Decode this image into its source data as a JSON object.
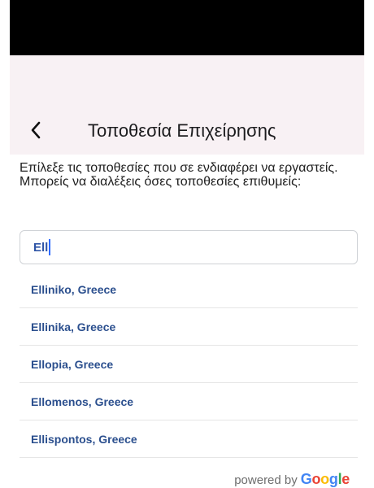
{
  "header": {
    "title": "Τοποθεσία Επιχείρησης"
  },
  "description": "Επίλεξε τις τοποθεσίες που σε ενδιαφέρει να εργαστείς. Μπορείς να διαλέξεις όσες τοποθεσίες επιθυμείς:",
  "search": {
    "value": "Ell"
  },
  "results": [
    "Elliniko, Greece",
    "Ellinika, Greece",
    "Ellopia, Greece",
    "Ellomenos, Greece",
    "Ellispontos, Greece"
  ],
  "attribution": {
    "powered_by": "powered by",
    "google": "Google",
    "google_letter_colors": [
      "#4285F4",
      "#EA4335",
      "#FBBC05",
      "#4285F4",
      "#34A853",
      "#EA4335"
    ]
  },
  "colors": {
    "header_bg": "#f8f1f4",
    "link_text": "#2b4f8e",
    "caret": "#2f6bff"
  }
}
